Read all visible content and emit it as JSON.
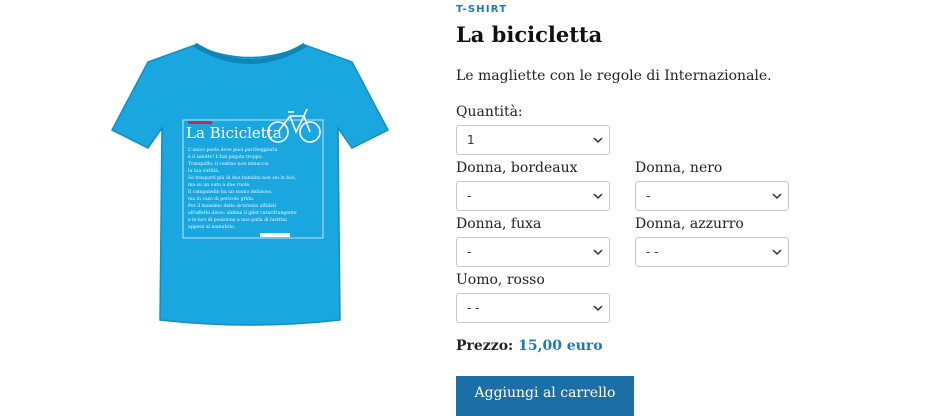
{
  "product": {
    "category": "T-SHIRT",
    "title": "La bicicletta",
    "description": "Le magliette con le regole di Internazionale.",
    "image": {
      "shirt_color": "#1aa7e0",
      "print_title": "La Bicicletta",
      "print_lines": [
        "L'unico posto dove puoi parcheggiarla",
        "è il salotto! L'hai pagata troppo.",
        "Tranquillo: il cestino non minaccia",
        "la tua virilità.",
        "Se trasporti più di due bambini non sei in bici,",
        "ma su un auto a due ruote.",
        "Il campanello ha un suono delizioso,",
        "ma in caso di pericolo grida.",
        "Per il massimo della sicurezza affidati",
        "all'effetto disco: abbina il gilet catarifrangente",
        "e le luci di posizione a una palla di lustrini",
        "appesa al manubrio."
      ]
    }
  },
  "form": {
    "quantity_label": "Quantità:",
    "quantity_value": "1",
    "options": [
      {
        "label": "Donna, bordeaux",
        "value": "-"
      },
      {
        "label": "Donna, nero",
        "value": "-"
      },
      {
        "label": "Donna, fuxa",
        "value": "-"
      },
      {
        "label": "Donna, azzurro",
        "value": "- -"
      },
      {
        "label": "Uomo, rosso",
        "value": "- -"
      }
    ]
  },
  "price": {
    "label": "Prezzo:",
    "amount": "15,00 euro"
  },
  "cart_button": "Aggiungi al carrello",
  "colors": {
    "accent": "#1f78b4",
    "button": "#1b6fa6"
  }
}
